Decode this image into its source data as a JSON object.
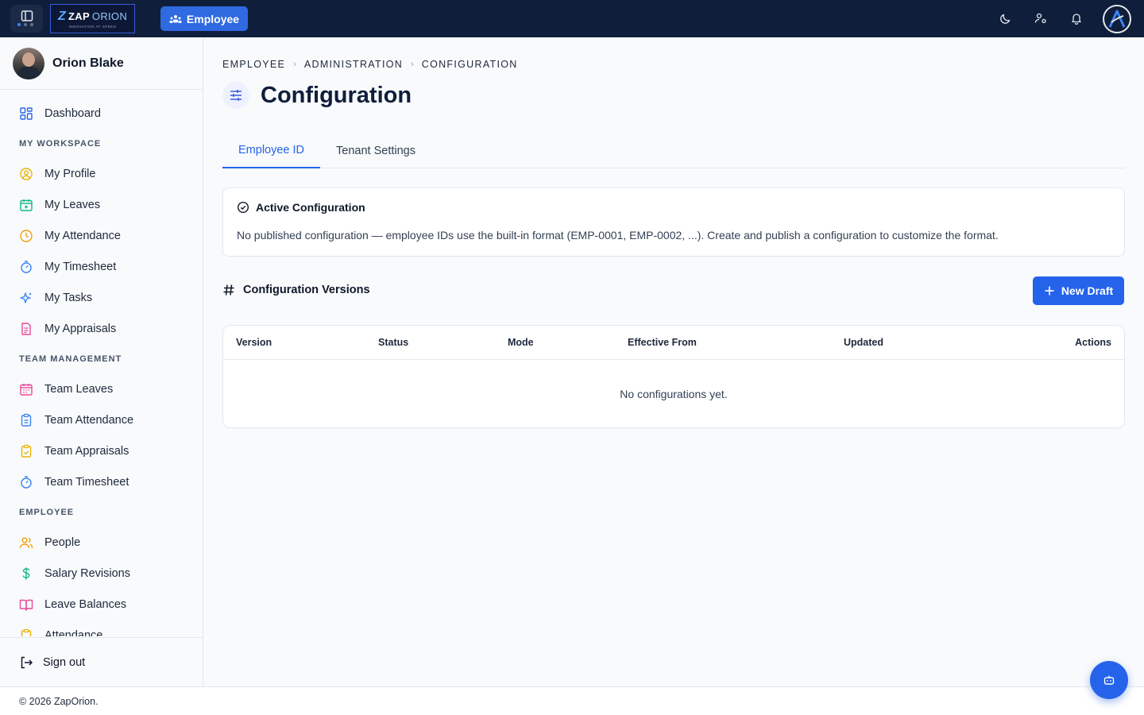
{
  "topbar": {
    "logo_brand_a": "ZAP",
    "logo_brand_b": "ORION",
    "logo_tagline": "INNOVATION AT SPEED",
    "module_label": "Employee"
  },
  "user": {
    "name": "Orion Blake"
  },
  "sidebar": {
    "dashboard": "Dashboard",
    "section_workspace": "MY WORKSPACE",
    "workspace_items": [
      "My Profile",
      "My Leaves",
      "My Attendance",
      "My Timesheet",
      "My Tasks",
      "My Appraisals"
    ],
    "section_team": "TEAM MANAGEMENT",
    "team_items": [
      "Team Leaves",
      "Team Attendance",
      "Team Appraisals",
      "Team Timesheet"
    ],
    "section_employee": "EMPLOYEE",
    "employee_items": [
      "People",
      "Salary Revisions",
      "Leave Balances",
      "Attendance"
    ],
    "sign_out": "Sign out"
  },
  "breadcrumb": [
    "EMPLOYEE",
    "ADMINISTRATION",
    "CONFIGURATION"
  ],
  "page_title": "Configuration",
  "tabs": [
    "Employee ID",
    "Tenant Settings"
  ],
  "active_config": {
    "title": "Active Configuration",
    "message": "No published configuration — employee IDs use the built-in format (EMP-0001, EMP-0002, ...). Create and publish a configuration to customize the format."
  },
  "versions": {
    "title": "Configuration Versions",
    "new_draft_label": "New Draft",
    "columns": [
      "Version",
      "Status",
      "Mode",
      "Effective From",
      "Updated",
      "Actions"
    ],
    "empty_message": "No configurations yet."
  },
  "footer": {
    "copyright": "© 2026 ZapOrion."
  },
  "colors": {
    "primary": "#2563eb",
    "topbar": "#0f1e3a"
  }
}
